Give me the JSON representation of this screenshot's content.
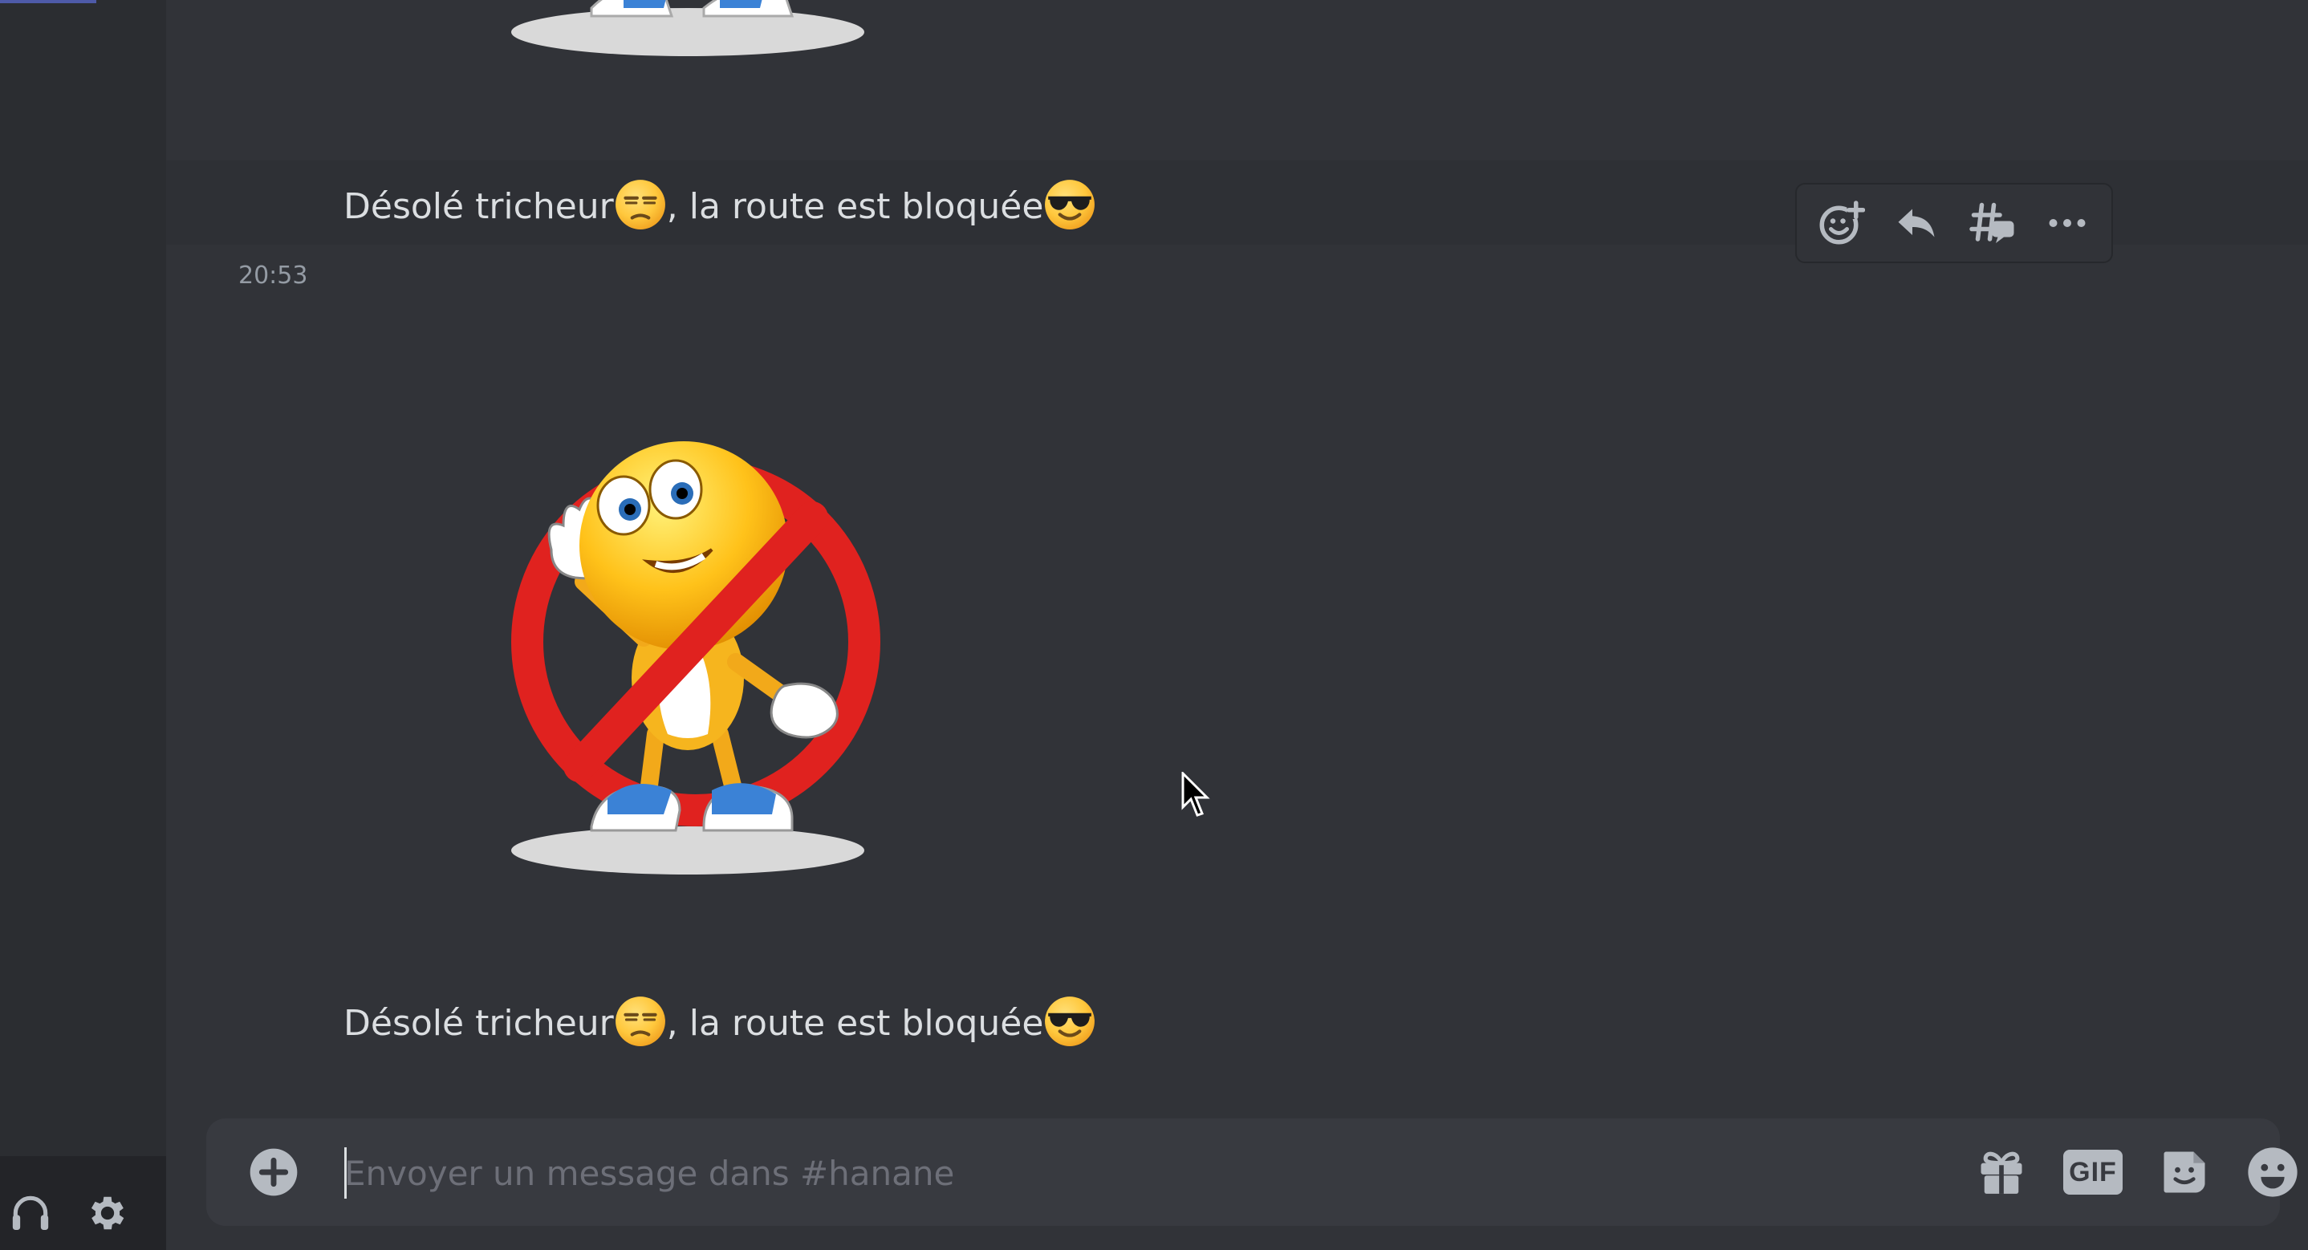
{
  "messages": [
    {
      "text_before": "Désolé tricheur",
      "text_middle": ", la route est bloquée",
      "emoji_1": "unamused-face",
      "emoji_2": "sunglasses-face"
    },
    {
      "timestamp": "20:53",
      "sticker": "no-cheating-smiley-sticker"
    },
    {
      "text_before": "Désolé tricheur",
      "text_middle": ", la route est bloquée",
      "emoji_1": "unamused-face",
      "emoji_2": "sunglasses-face"
    }
  ],
  "toolbar": {
    "icons": [
      "add-reaction-icon",
      "reply-icon",
      "create-thread-icon",
      "more-icon"
    ]
  },
  "composer": {
    "placeholder": "Envoyer un message dans #hanane",
    "value": "",
    "icons": [
      "plus-circle-icon",
      "gift-icon",
      "gif-icon",
      "sticker-icon",
      "emoji-icon"
    ],
    "gif_label": "GIF"
  },
  "sidebar": {
    "icons": [
      "headphones-icon",
      "gear-icon"
    ]
  },
  "colors": {
    "background": "#313338",
    "sidebar": "#2b2d31",
    "composer": "#383a40",
    "text": "#dbdee1",
    "muted": "#949ba4"
  }
}
